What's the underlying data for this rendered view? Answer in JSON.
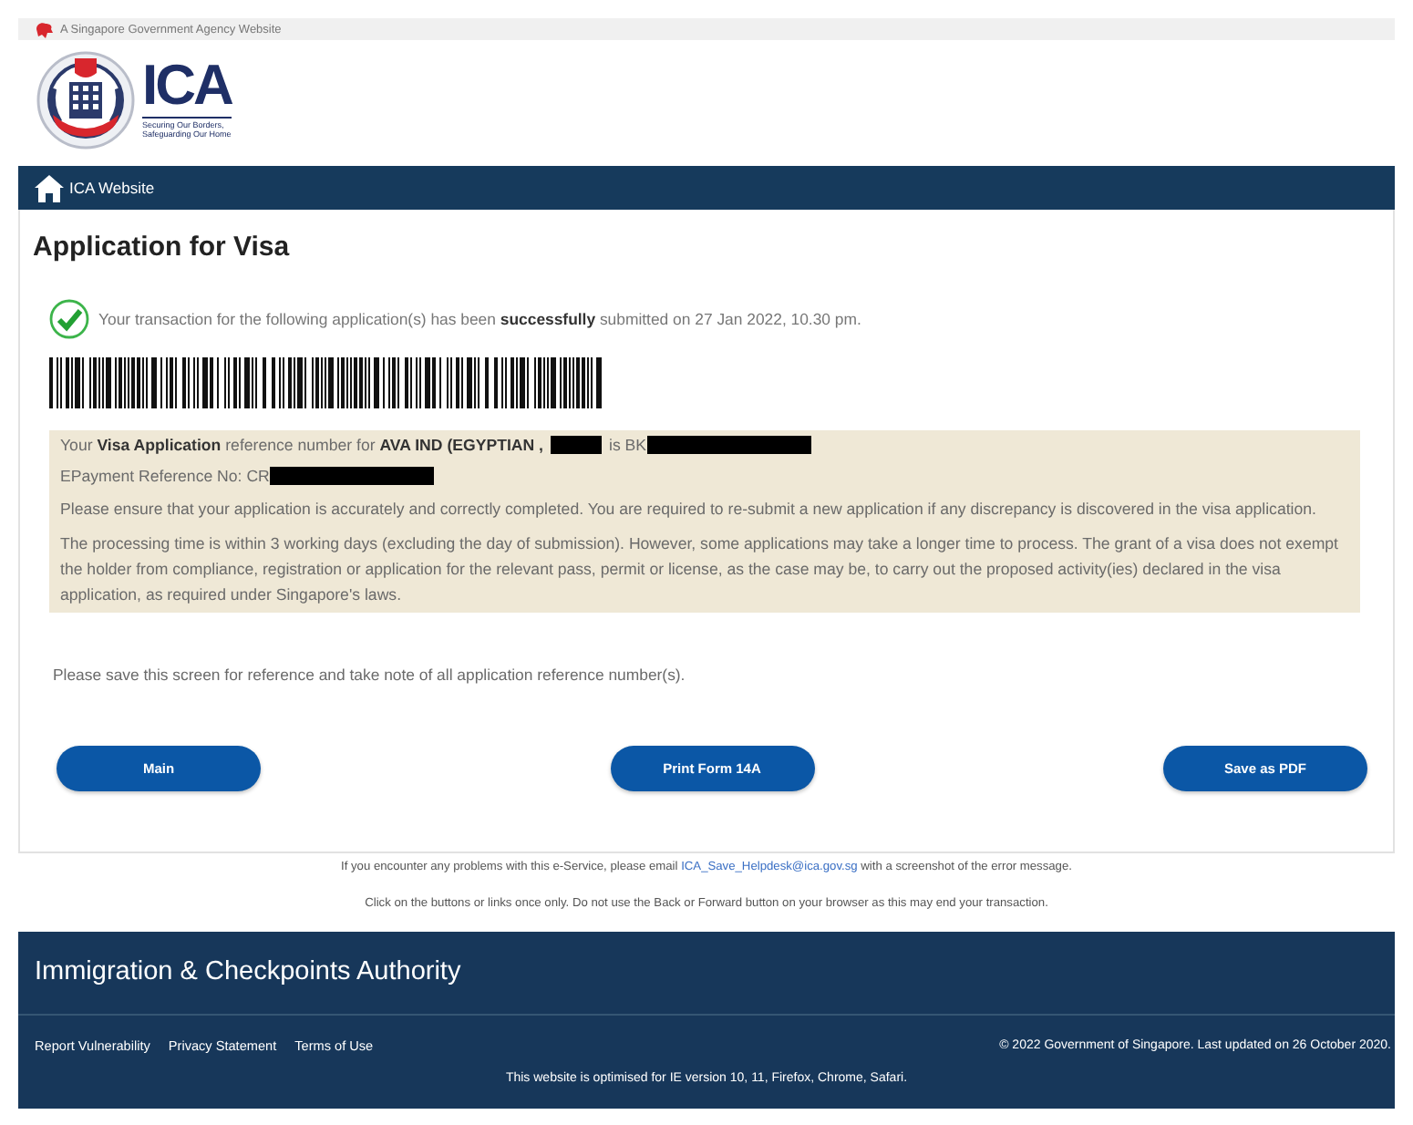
{
  "masthead": {
    "text": "A Singapore Government Agency Website"
  },
  "logo": {
    "name": "ICA",
    "tagline_lines": [
      "Securing Our Borders,",
      "Safeguarding Our Home"
    ]
  },
  "nav": {
    "link": "ICA Website"
  },
  "application": {
    "title": "Application for Visa",
    "status": {
      "kind": "success",
      "message": "Your transaction for the following application(s) has been **successfully** submitted on 27 Jan 2022, 10.30 pm."
    },
    "notice": {
      "lines": [
        {
          "kind": "reference",
          "parts": [
            {
              "kind": "text",
              "text": "Your **Visa Application** reference number for **AVA IND (EGYPTIAN ,**"
            },
            {
              "kind": "redaction",
              "wide": false
            },
            {
              "kind": "text",
              "text": "is BK"
            },
            {
              "kind": "redaction",
              "wide": true
            }
          ]
        },
        {
          "kind": "reference",
          "parts": [
            {
              "kind": "text",
              "text": "EPayment Reference No: CR"
            },
            {
              "kind": "redaction",
              "wide": true
            }
          ]
        },
        {
          "kind": "paragraph",
          "text": "Please ensure that your application is accurately and correctly completed. You are required to re-submit a new application if any discrepancy is discovered in the visa application."
        },
        {
          "kind": "paragraph",
          "text": "The processing time is within 3 working days (excluding the day of submission). However, some applications may take a longer time to process. The grant of a visa does not exempt the holder from compliance, registration or application for the relevant pass, permit or license, as the case may be, to carry out the proposed activity(ies) declared in the visa application, as required under Singapore's laws."
        }
      ]
    },
    "save_note": "Please save this screen for reference and take note of all application reference number(s).",
    "buttons": [
      "Main",
      "Print Form 14A",
      "Save as PDF"
    ]
  },
  "help_notes": [
    {
      "before": "If you encounter any problems with this e-Service, please email",
      "link": "ICA_Save_Helpdesk@ica.gov.sg",
      "after": "with a screenshot of the error message."
    },
    {
      "before": "Click on the buttons or links once only. Do not use the Back or Forward button on your browser as this may end your transaction."
    }
  ],
  "footer": {
    "title": "Immigration & Checkpoints Authority",
    "links": [
      "Report Vulnerability",
      "Privacy Statement",
      "Terms of Use"
    ],
    "copyright": "© 2022 Government of Singapore. Last updated on 26 October 2020.",
    "browser_note": "This website is optimised for IE version 10, 11, Firefox, Chrome, Safari."
  }
}
